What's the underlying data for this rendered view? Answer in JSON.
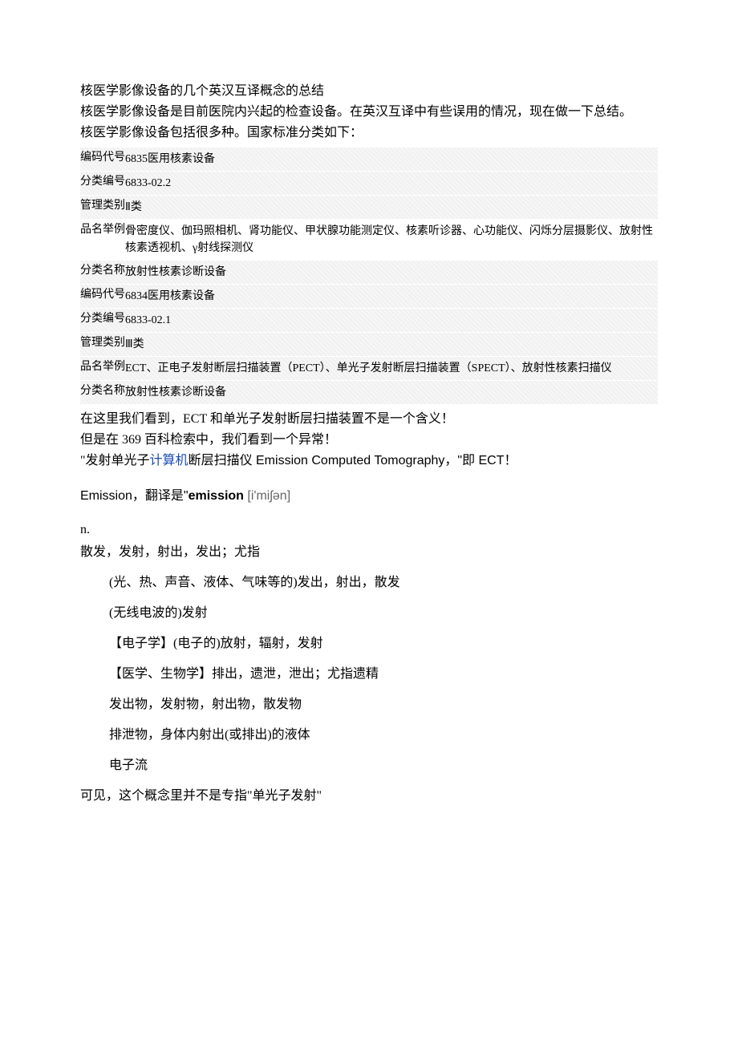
{
  "title": "核医学影像设备的几个英汉互译概念的总结",
  "intro1": "核医学影像设备是目前医院内兴起的检查设备。在英汉互译中有些误用的情况，现在做一下总结。",
  "intro2": "核医学影像设备包括很多种。国家标准分类如下：",
  "table1": {
    "r1": {
      "label": "编码代号",
      "value": "6835医用核素设备"
    },
    "r2": {
      "label": "分类编号",
      "value": "6833-02.2"
    },
    "r3": {
      "label": "管理类别",
      "value": "Ⅱ类"
    },
    "r4": {
      "label": "品名举例",
      "value": "骨密度仪、伽玛照相机、肾功能仪、甲状腺功能测定仪、核素听诊器、心功能仪、闪烁分层摄影仪、放射性核素透视机、γ射线探测仪"
    },
    "r5": {
      "label": "分类名称",
      "value": "放射性核素诊断设备"
    },
    "r6": {
      "label": "编码代号",
      "value": "6834医用核素设备"
    },
    "r7": {
      "label": "分类编号",
      "value": "6833-02.1"
    },
    "r8": {
      "label": "管理类别",
      "value": "Ⅲ类"
    },
    "r9": {
      "label": "品名举例",
      "value": "ECT、正电子发射断层扫描装置（PECT）、单光子发射断层扫描装置（SPECT）、放射性核素扫描仪"
    },
    "r10": {
      "label": "分类名称",
      "value": "放射性核素诊断设备"
    }
  },
  "body1": "在这里我们看到，ECT 和单光子发射断层扫描装置不是一个含义！",
  "body2a": "但是在 369 百科检索中，我们看到一个异常！",
  "body3_prefix": "\"发射单光子",
  "body3_link": "计算机",
  "body3_suffix": "断层扫描仪 Emission Computed Tomography，\"即 ECT！",
  "emission_label": "Emission，翻译是\"",
  "emission_bold": "emission",
  "emission_phonetic": " [i'miʃən]",
  "pos": "n.",
  "def0": "散发，发射，射出，发出；尤指",
  "defs": {
    "d1": "(光、热、声音、液体、气味等的)发出，射出，散发",
    "d2": "(无线电波的)发射",
    "d3": "【电子学】(电子的)放射，辐射，发射",
    "d4": "【医学、生物学】排出，遗泄，泄出；尤指遗精",
    "d5": "发出物，发射物，射出物，散发物",
    "d6": "排泄物，身体内射出(或排出)的液体",
    "d7": "电子流"
  },
  "conclusion": "可见，这个概念里并不是专指\"单光子发射\""
}
